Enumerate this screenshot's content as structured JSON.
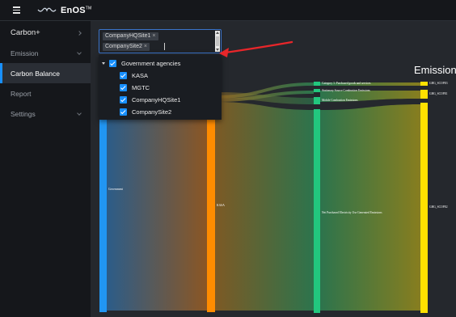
{
  "app": {
    "logo_text": "EnOS",
    "logo_mark": "TM"
  },
  "sidebar": {
    "items": [
      {
        "label": "Carbon+",
        "icon": "chevron-right-icon"
      },
      {
        "label": "Emission",
        "icon": "chevron-down-icon"
      },
      {
        "label": "Carbon Balance",
        "icon": ""
      },
      {
        "label": "Report",
        "icon": ""
      },
      {
        "label": "Settings",
        "icon": "chevron-down-icon"
      }
    ],
    "active_item": "Carbon Balance"
  },
  "select": {
    "tags": [
      {
        "label": "CompanyHQSite1"
      },
      {
        "label": "CompanySite2"
      }
    ]
  },
  "dropdown": {
    "parent": {
      "label": "Government agencies",
      "checked": true
    },
    "children": [
      {
        "label": "KASA",
        "checked": true
      },
      {
        "label": "MGTC",
        "checked": true
      },
      {
        "label": "CompanyHQSite1",
        "checked": true
      },
      {
        "label": "CompanySite2",
        "checked": true
      }
    ]
  },
  "sankey": {
    "column_title": "Emission",
    "nodes": [
      {
        "label": "Government",
        "color": "#2196f3"
      },
      {
        "label": "KASA",
        "color": "#ff8c00"
      },
      {
        "label": "Category 1: Purchased goods and services",
        "color": "#22c77e"
      },
      {
        "label": "Stationary Source Combustion Emissions",
        "color": "#22c77e"
      },
      {
        "label": "Mobile Combustion Emissions",
        "color": "#22c77e"
      },
      {
        "label": "Net Purchased Electricity Use Generated Emissions",
        "color": "#22c77e"
      },
      {
        "label": "GHG_SCOPE3",
        "color": "#ffe100"
      },
      {
        "label": "GHG_SCOPE1",
        "color": "#ffe100"
      },
      {
        "label": "GHG_SCOPE2",
        "color": "#ffe100"
      }
    ]
  },
  "colors": {
    "accent": "#1890ff",
    "annotation_arrow": "#e8262a"
  }
}
